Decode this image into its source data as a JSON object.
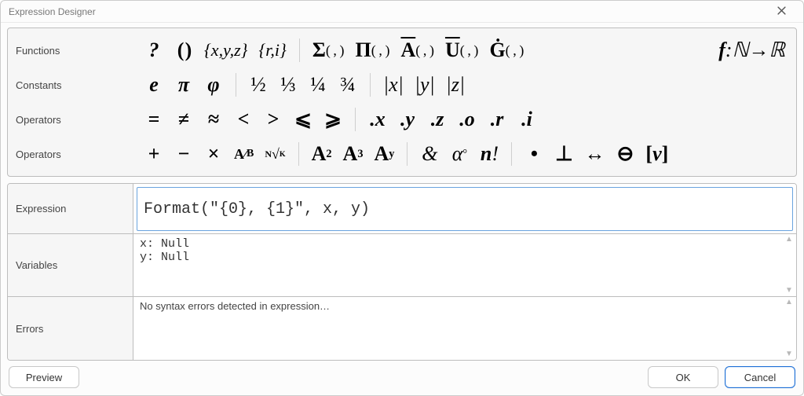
{
  "window": {
    "title": "Expression Designer"
  },
  "ribbon": {
    "row1": {
      "label": "Functions"
    },
    "row2": {
      "label": "Constants"
    },
    "row3": {
      "label": "Operators"
    },
    "row4": {
      "label": "Operators"
    },
    "items1": {
      "help": "?",
      "parens": "( )",
      "set_xyz": "{x,y,z}",
      "set_ri": "{r,i}",
      "sigma": "Σ( , )",
      "pi_prod": "Π( , )",
      "a_bar": "A( , )",
      "u_bar": "U( , )",
      "g_dot": "Ġ( , )",
      "fn_nr": "f:ℕ→ℝ"
    },
    "items2": {
      "e": "e",
      "pi": "π",
      "phi": "φ",
      "half": "½",
      "third": "⅓",
      "quarter": "¼",
      "threeq": "¾",
      "abs_x": "|x|",
      "abs_y": "|y|",
      "abs_z": "|z|"
    },
    "items3": {
      "eq": "=",
      "neq": "≠",
      "approx": "≈",
      "lt": "<",
      "gt": ">",
      "le": "⩽",
      "ge": "⩾",
      "dot_x": ".x",
      "dot_y": ".y",
      "dot_z": ".z",
      "dot_o": ".o",
      "dot_r": ".r",
      "dot_i": ".i"
    },
    "items4": {
      "plus": "+",
      "minus": "−",
      "times": "×",
      "frac_ab": "A⁄B",
      "root_nk": "ɴᴷ",
      "a2": "A²",
      "a3": "A³",
      "ay": "Aʸ",
      "amp": "&",
      "alpha_deg": "α°",
      "nfact": "n!",
      "dot": "•",
      "perp": "⊥",
      "bidir": "↔",
      "ominus": "⊖",
      "bracket_v": "[v]"
    }
  },
  "panels": {
    "expression": {
      "label": "Expression",
      "value": "Format(\"{0}, {1}\", x, y)"
    },
    "variables": {
      "label": "Variables",
      "text": "x: Null\ny: Null"
    },
    "errors": {
      "label": "Errors",
      "text": "No syntax errors detected in expression…"
    }
  },
  "footer": {
    "preview": "Preview",
    "ok": "OK",
    "cancel": "Cancel"
  }
}
